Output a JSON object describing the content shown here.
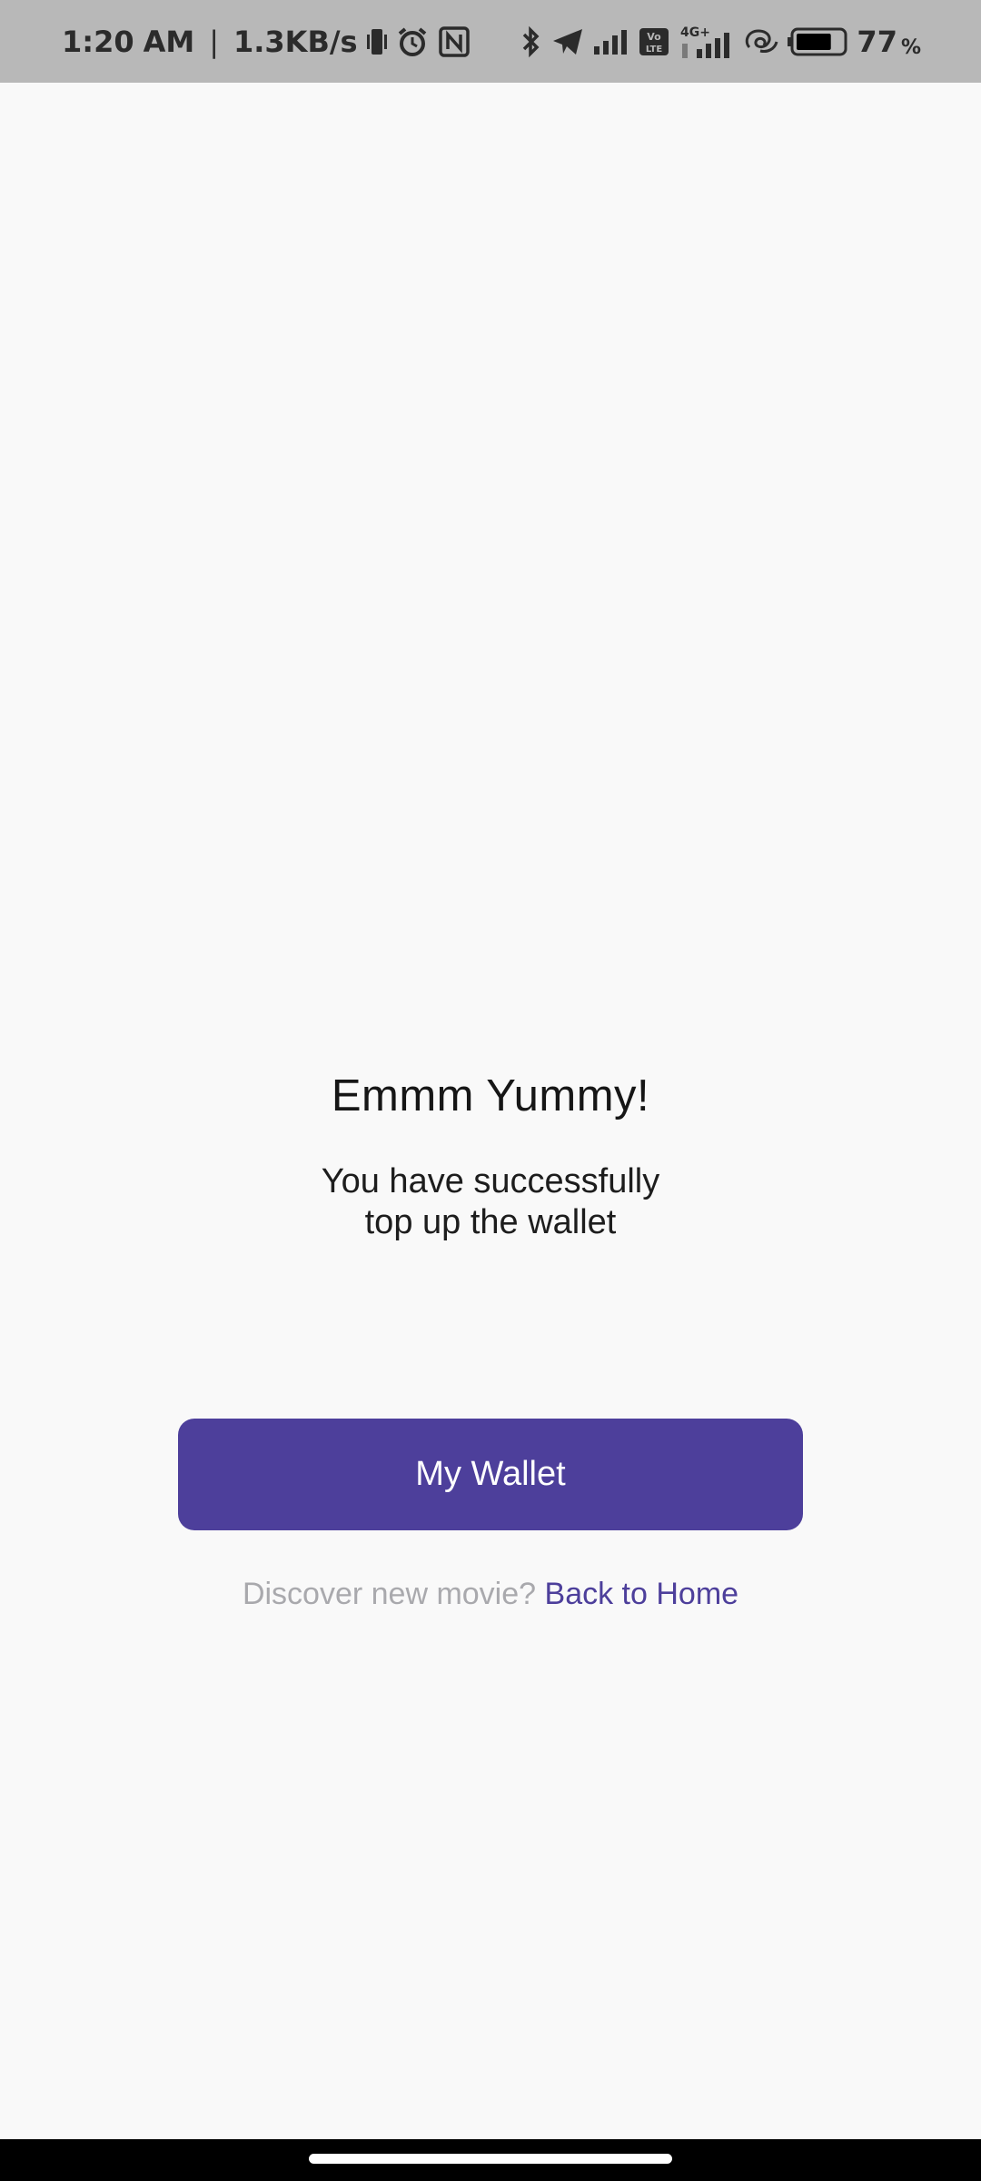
{
  "status_bar": {
    "time": "1:20",
    "ampm": "AM",
    "separator": "|",
    "net_speed": "1.3KB/s",
    "network_label": "4G+",
    "volte_label": "Vo LTE",
    "battery_level": 77,
    "battery_number": "77",
    "battery_unit": "%",
    "icons": [
      "vibrate-icon",
      "alarm-icon",
      "nfc-icon",
      "bluetooth-icon",
      "telegram-icon",
      "signal-icon",
      "volte-icon",
      "signal-4g-icon",
      "hotspot-icon",
      "battery-icon"
    ]
  },
  "content": {
    "title": "Emmm Yummy!",
    "message_line1": "You have successfully",
    "message_line2": "top up the wallet",
    "wallet_button_label": "My Wallet",
    "discover_prompt": "Discover new movie?",
    "back_home_link": "Back to Home"
  },
  "colors": {
    "background": "#f9f9f9",
    "status_bar": "#b8b8b8",
    "accent": "#4d3f9b",
    "muted_text": "#a9a9ad",
    "title_text": "#161616"
  }
}
